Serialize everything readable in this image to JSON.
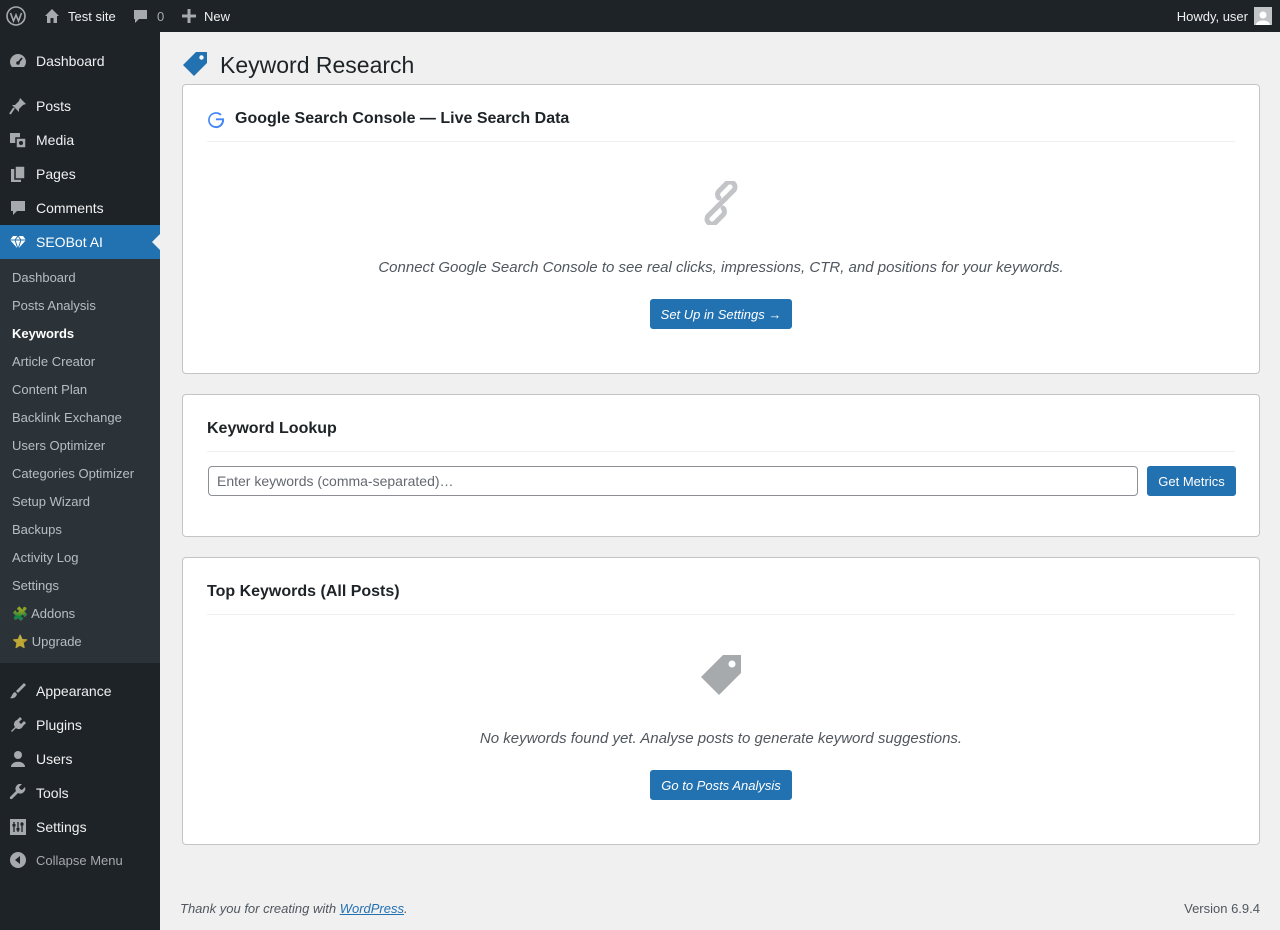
{
  "adminbar": {
    "site_name": "Test site",
    "comments_count": "0",
    "new_label": "New",
    "howdy": "Howdy, user"
  },
  "sidebar": {
    "items_top": [
      {
        "label": "Dashboard",
        "icon": "dashboard-icon"
      },
      {
        "label": "Posts",
        "icon": "pushpin-icon"
      },
      {
        "label": "Media",
        "icon": "media-icon"
      },
      {
        "label": "Pages",
        "icon": "pages-icon"
      },
      {
        "label": "Comments",
        "icon": "comment-icon"
      },
      {
        "label": "SEOBot AI",
        "icon": "diamond-icon"
      }
    ],
    "submenu": [
      "Dashboard",
      "Posts Analysis",
      "Keywords",
      "Article Creator",
      "Content Plan",
      "Backlink Exchange",
      "Users Optimizer",
      "Categories Optimizer",
      "Setup Wizard",
      "Backups",
      "Activity Log",
      "Settings",
      "🧩 Addons",
      "⭐ Upgrade"
    ],
    "current_submenu": "Keywords",
    "items_bottom": [
      {
        "label": "Appearance",
        "icon": "brush-icon"
      },
      {
        "label": "Plugins",
        "icon": "plugin-icon"
      },
      {
        "label": "Users",
        "icon": "user-icon"
      },
      {
        "label": "Tools",
        "icon": "wrench-icon"
      },
      {
        "label": "Settings",
        "icon": "settings-icon"
      }
    ],
    "collapse_label": "Collapse Menu"
  },
  "page": {
    "title": "Keyword Research"
  },
  "gsc_card": {
    "title": "Google Search Console — Live Search Data",
    "message": "Connect Google Search Console to see real clicks, impressions, CTR, and positions for your keywords.",
    "button": "Set Up in Settings →"
  },
  "lookup_card": {
    "title": "Keyword Lookup",
    "placeholder": "Enter keywords (comma-separated)…",
    "button": "Get Metrics"
  },
  "top_card": {
    "title": "Top Keywords (All Posts)",
    "message": "No keywords found yet. Analyse posts to generate keyword suggestions.",
    "button": "Go to Posts Analysis"
  },
  "footer": {
    "thanks_prefix": "Thank you for creating with ",
    "wp_link": "WordPress",
    "thanks_suffix": ".",
    "version": "Version 6.9.4"
  },
  "colors": {
    "admin_dark": "#1d2327",
    "submenu_bg": "#2c3338",
    "accent": "#2271b1",
    "background": "#f0f0f1",
    "icon_gray": "#a7aaad"
  }
}
